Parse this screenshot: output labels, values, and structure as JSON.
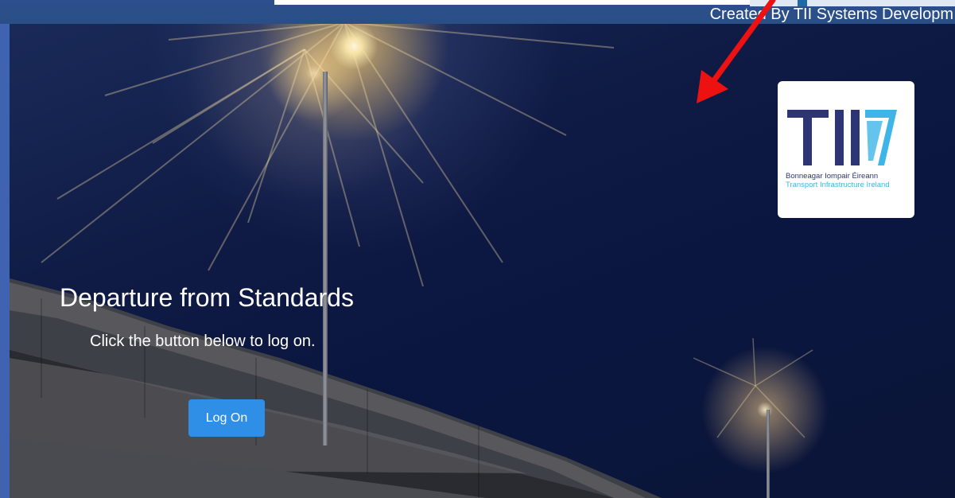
{
  "header": {
    "credit_text": "Created By TII Systems Developm"
  },
  "logo": {
    "letters": "TII",
    "line1": "Bonneagar Iompair Éireann",
    "line2": "Transport Infrastructure Ireland",
    "colors": {
      "navy": "#2e3575",
      "cyan": "#3db5e6"
    }
  },
  "main": {
    "title": "Departure from Standards",
    "subtitle": "Click the button below to log on.",
    "logon_label": "Log On"
  },
  "colors": {
    "frame": "#3f63b0",
    "button": "#2f8ee6",
    "annotation": "#ee1111"
  }
}
